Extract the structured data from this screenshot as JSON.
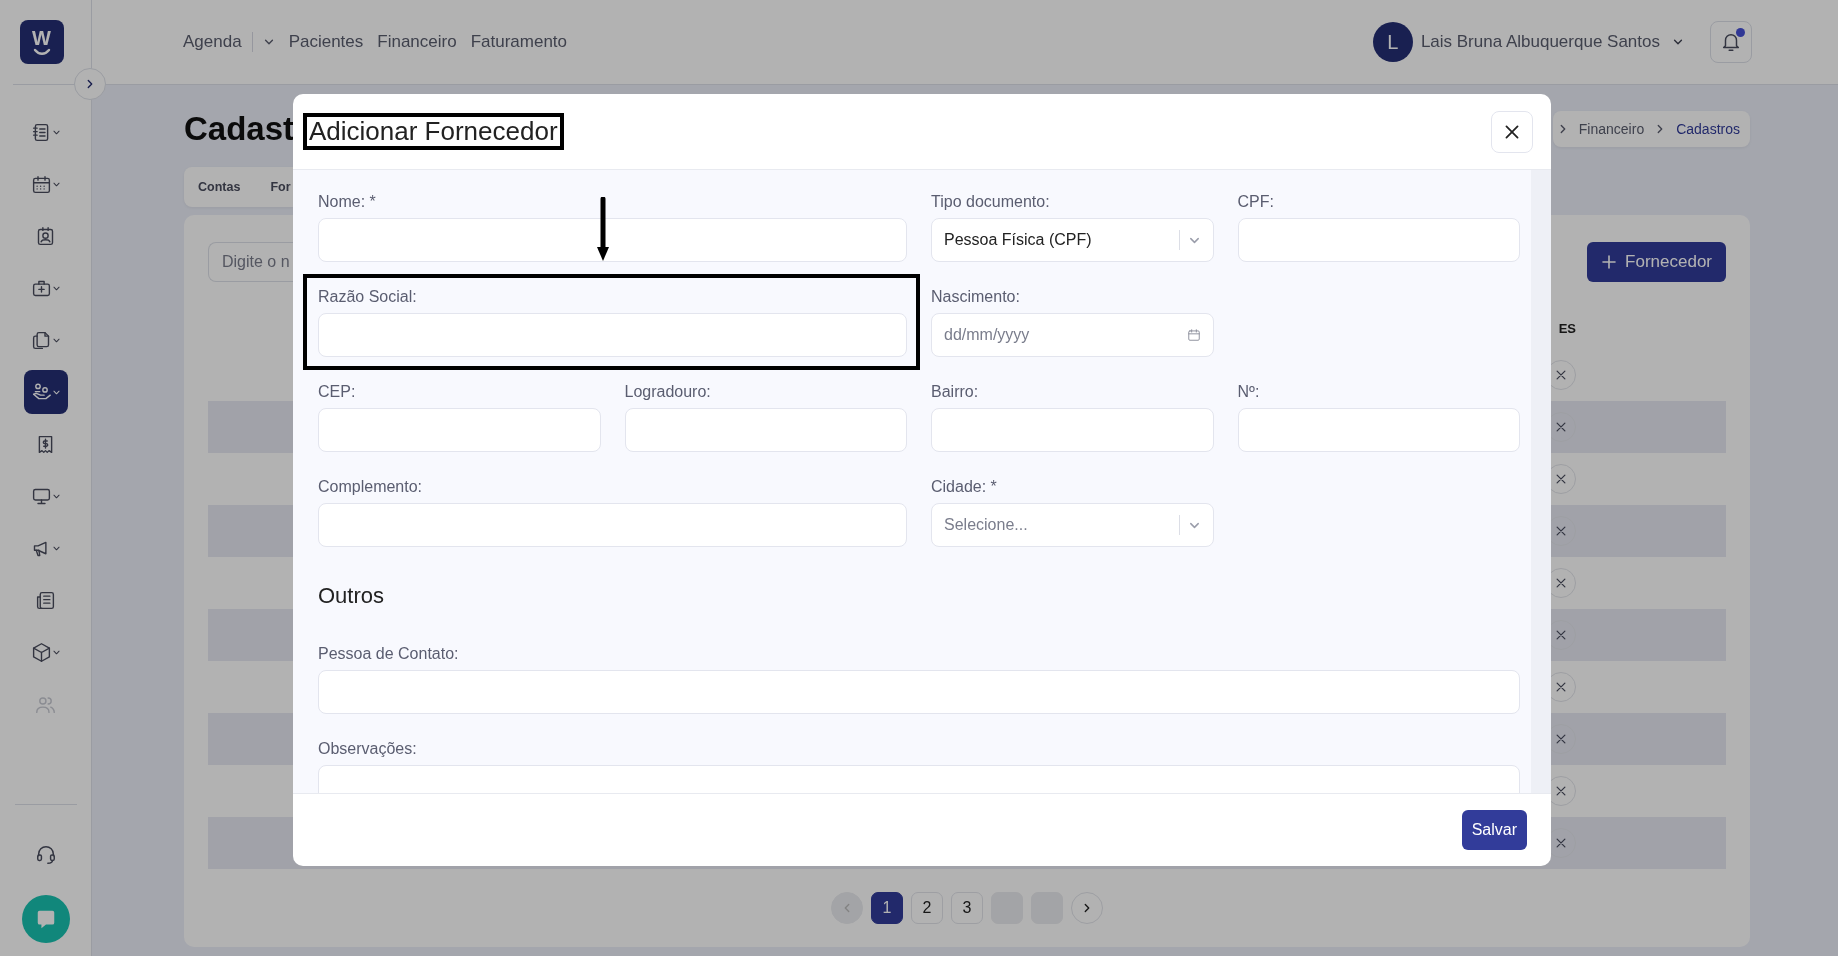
{
  "sidebar": {
    "logo": "W",
    "items": [
      {
        "has_menu": true,
        "selected": false,
        "disabled": false
      },
      {
        "has_menu": true,
        "selected": false,
        "disabled": false
      },
      {
        "has_menu": false,
        "selected": false,
        "disabled": false
      },
      {
        "has_menu": true,
        "selected": false,
        "disabled": false
      },
      {
        "has_menu": true,
        "selected": false,
        "disabled": false
      },
      {
        "has_menu": true,
        "selected": true,
        "disabled": false
      },
      {
        "has_menu": false,
        "selected": false,
        "disabled": false
      },
      {
        "has_menu": true,
        "selected": false,
        "disabled": false
      },
      {
        "has_menu": true,
        "selected": false,
        "disabled": false
      },
      {
        "has_menu": false,
        "selected": false,
        "disabled": false
      },
      {
        "has_menu": true,
        "selected": false,
        "disabled": false
      },
      {
        "has_menu": false,
        "selected": false,
        "disabled": true
      }
    ]
  },
  "topbar": {
    "nav": [
      {
        "label": "Agenda",
        "has_menu": true
      },
      {
        "label": "Pacientes",
        "has_menu": false
      },
      {
        "label": "Financeiro",
        "has_menu": false
      },
      {
        "label": "Faturamento",
        "has_menu": false
      }
    ],
    "user": {
      "initial": "L",
      "name": "Lais Bruna Albuquerque Santos"
    },
    "notifications": {
      "unread": true
    }
  },
  "page": {
    "title": "Cadast",
    "breadcrumb": [
      {
        "label": "Financeiro",
        "current": false
      },
      {
        "label": "Cadastros",
        "current": true
      }
    ],
    "tabs": [
      {
        "label": "Contas",
        "selected": false
      },
      {
        "label": "For",
        "selected": false
      }
    ],
    "search": {
      "placeholder": "Digite o n"
    },
    "add_button": "Fornecedor",
    "column_header": "ES",
    "rows": [
      {
        "shaded": false
      },
      {
        "shaded": true
      },
      {
        "shaded": false
      },
      {
        "shaded": true
      },
      {
        "shaded": false
      },
      {
        "shaded": true
      },
      {
        "shaded": false
      },
      {
        "shaded": true
      },
      {
        "shaded": false
      },
      {
        "shaded": true
      }
    ],
    "pagination": [
      {
        "kind": "prev",
        "disabled": true
      },
      {
        "kind": "page",
        "label": "1",
        "selected": true
      },
      {
        "kind": "page",
        "label": "2",
        "selected": false
      },
      {
        "kind": "page",
        "label": "3",
        "selected": false
      },
      {
        "kind": "blank"
      },
      {
        "kind": "blank"
      },
      {
        "kind": "next",
        "disabled": false
      }
    ]
  },
  "modal": {
    "title": "Adicionar Fornecedor",
    "title_highlighted": true,
    "sections": [
      {
        "fields": [
          {
            "label": "Nome: *",
            "kind": "text",
            "highlighted": false
          },
          {
            "label": "Tipo documento:",
            "kind": "select",
            "value": "Pessoa Física (CPF)",
            "highlighted": false
          },
          {
            "label": "CPF:",
            "kind": "text",
            "highlighted": false
          },
          {
            "label": "Razão Social:",
            "kind": "text",
            "highlighted": true
          },
          {
            "label": "Nascimento:",
            "kind": "date",
            "placeholder": "dd/mm/yyyy",
            "highlighted": false
          },
          {
            "label": "CEP:",
            "kind": "text",
            "highlighted": false
          },
          {
            "label": "Logradouro:",
            "kind": "text",
            "highlighted": false
          },
          {
            "label": "Bairro:",
            "kind": "text",
            "highlighted": false
          },
          {
            "label": "Nº:",
            "kind": "text",
            "highlighted": false
          },
          {
            "label": "Complemento:",
            "kind": "text",
            "highlighted": false
          },
          {
            "label": "Cidade: *",
            "kind": "select",
            "placeholder": "Selecione...",
            "highlighted": false
          }
        ]
      },
      {
        "heading": "Outros",
        "fields": [
          {
            "label": "Pessoa de Contato:",
            "kind": "text",
            "highlighted": false
          },
          {
            "label": "Observações:",
            "kind": "textarea",
            "highlighted": false
          }
        ]
      }
    ],
    "annotations": [
      {
        "kind": "arrow"
      }
    ],
    "save_button": "Salvar"
  }
}
